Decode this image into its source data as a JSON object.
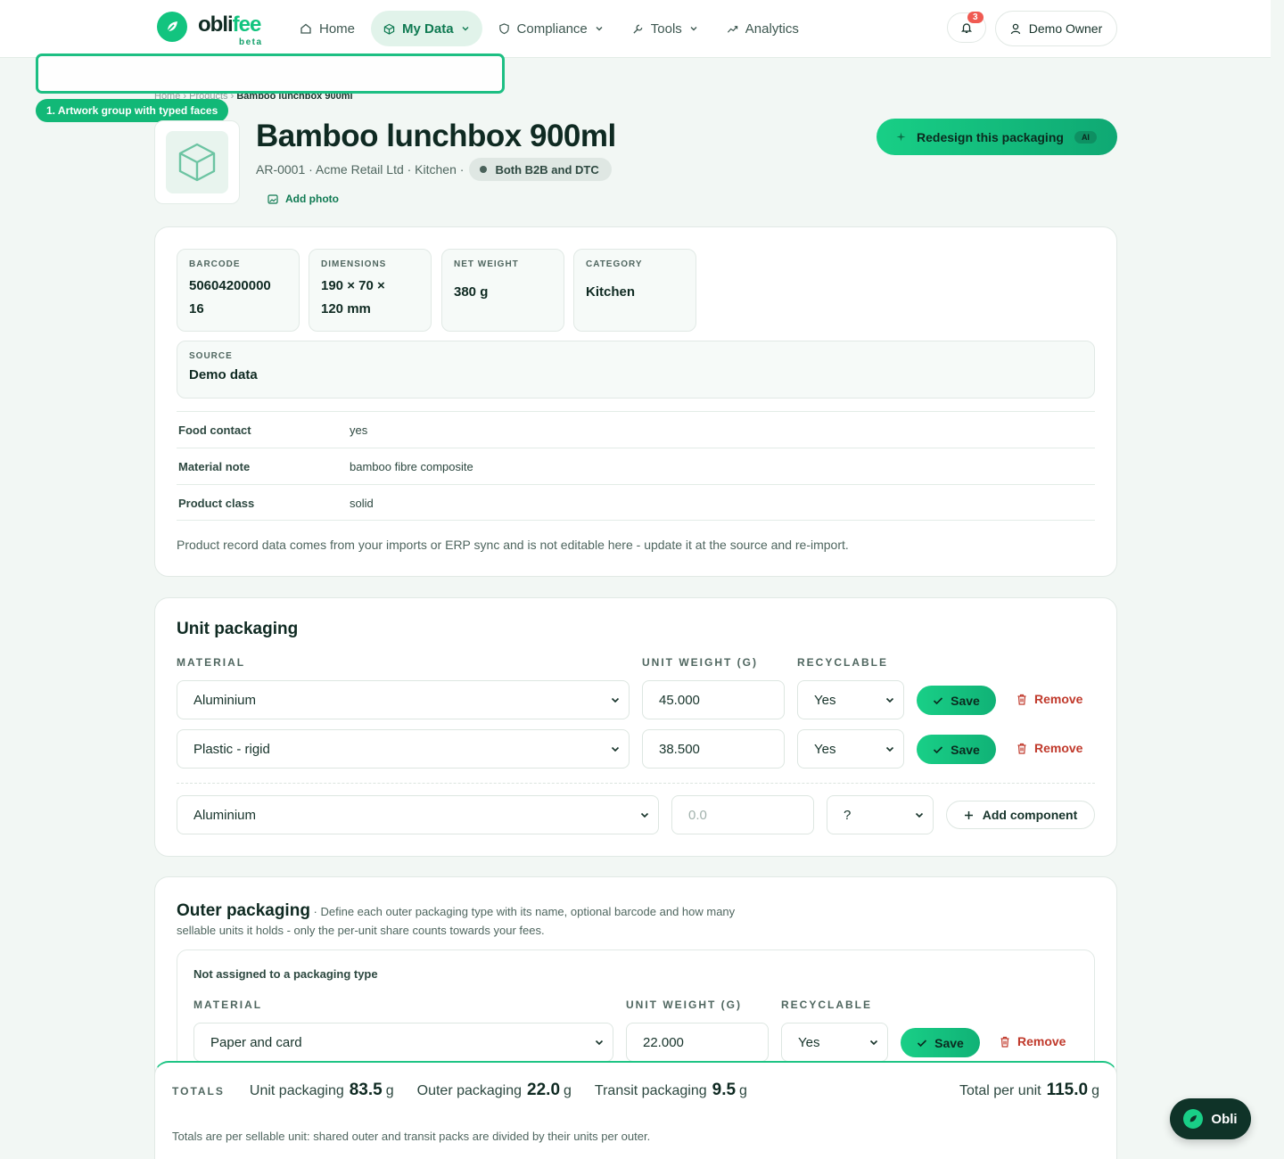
{
  "brand": {
    "name_a": "obli",
    "name_b": "fee",
    "beta": "beta"
  },
  "nav": [
    {
      "label": "Home",
      "icon": "home-icon"
    },
    {
      "label": "My Data",
      "icon": "cube-icon",
      "active": true
    },
    {
      "label": "Compliance",
      "icon": "shield-icon"
    },
    {
      "label": "Tools",
      "icon": "wrench-icon"
    },
    {
      "label": "Analytics",
      "icon": "trend-icon"
    }
  ],
  "notifications": {
    "count": "3"
  },
  "user": {
    "name": "Demo Owner"
  },
  "highlight": {
    "label": "1. Artwork group with typed faces"
  },
  "breadcrumb": {
    "home": "Home",
    "products": "Products",
    "current": "Bamboo lunchbox 900ml"
  },
  "product": {
    "title": "Bamboo lunchbox 900ml",
    "meta": "AR-0001 · Acme Retail Ltd · Kitchen ·",
    "channel": "Both B2B and DTC",
    "add_photo": "Add photo",
    "redesign_label": "Redesign this packaging",
    "ai_badge": "AI"
  },
  "record": {
    "stats": [
      {
        "label": "BARCODE",
        "value_l1": "50604200000",
        "value_l2": "16"
      },
      {
        "label": "DIMENSIONS",
        "value_l1": "190 × 70 ×",
        "value_l2": "120 mm"
      },
      {
        "label": "NET WEIGHT",
        "value": "380 g"
      },
      {
        "label": "CATEGORY",
        "value": "Kitchen"
      }
    ],
    "source": {
      "label": "SOURCE",
      "value": "Demo data"
    },
    "attributes": [
      {
        "key": "Food contact",
        "value": "yes"
      },
      {
        "key": "Material note",
        "value": "bamboo fibre composite"
      },
      {
        "key": "Product class",
        "value": "solid"
      }
    ],
    "note": "Product record data comes from your imports or ERP sync and is not editable here - update it at the source and re-import."
  },
  "unit_packaging": {
    "title": "Unit packaging",
    "headers": {
      "material": "MATERIAL",
      "weight": "UNIT WEIGHT (G)",
      "recyclable": "RECYCLABLE"
    },
    "rows": [
      {
        "material": "Aluminium",
        "weight": "45.000",
        "recyclable": "Yes"
      },
      {
        "material": "Plastic - rigid",
        "weight": "38.500",
        "recyclable": "Yes"
      }
    ],
    "save_label": "Save",
    "remove_label": "Remove",
    "new_row": {
      "material": "Aluminium",
      "weight_placeholder": "0.0",
      "recyclable": "?"
    },
    "add_label": "Add component"
  },
  "outer_packaging": {
    "title": "Outer packaging",
    "description": "· Define each outer packaging type with its name, optional barcode and how many sellable units it holds - only the per-unit share counts towards your fees.",
    "group_title": "Not assigned to a packaging type",
    "headers": {
      "material": "MATERIAL",
      "weight": "UNIT WEIGHT (G)",
      "recyclable": "RECYCLABLE"
    },
    "rows": [
      {
        "material": "Paper and card",
        "weight": "22.000",
        "recyclable": "Yes"
      }
    ],
    "save_label": "Save",
    "remove_label": "Remove"
  },
  "totals": {
    "label": "TOTALS",
    "unit_label": "Unit packaging",
    "unit_value": "83.5",
    "outer_label": "Outer packaging",
    "outer_value": "22.0",
    "transit_label": "Transit packaging",
    "transit_value": "9.5",
    "total_label": "Total per unit",
    "total_value": "115.0",
    "unit": "g",
    "note": "Totals are per sellable unit: shared outer and transit packs are divided by their units per outer."
  },
  "assistant": {
    "label": "Obli"
  }
}
